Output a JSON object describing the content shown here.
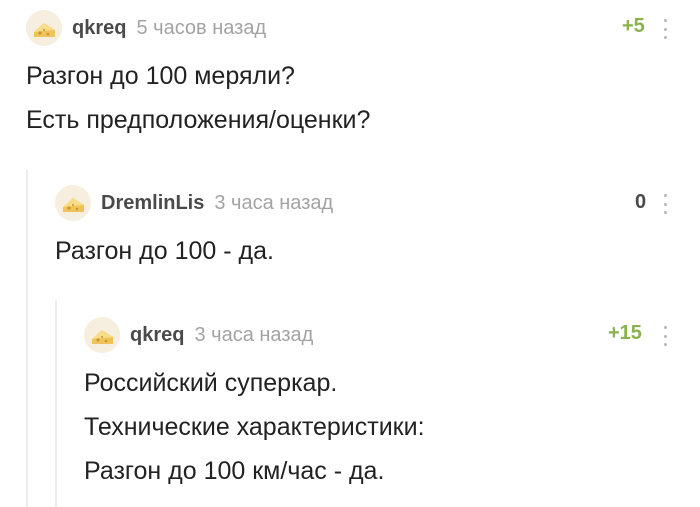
{
  "comments": [
    {
      "author": "qkreq",
      "time": "5 часов назад",
      "rating": "+5",
      "lines": [
        "Разгон до 100 меряли?",
        "Есть предположения/оценки?"
      ]
    },
    {
      "author": "DremlinLis",
      "time": "3 часа назад",
      "rating": "0",
      "lines": [
        "Разгон до 100 - да."
      ]
    },
    {
      "author": "qkreq",
      "time": "3 часа назад",
      "rating": "+15",
      "lines": [
        "Российский суперкар.",
        "Технические характеристики:",
        "Разгон до 100 км/час - да."
      ]
    }
  ],
  "colors": {
    "rating_positive": "#8ab14e",
    "rating_neutral": "#4a4a4a",
    "time": "#a3a3a3",
    "thread_line": "#ececec"
  },
  "icons": {
    "avatar": "cheese-avatar-icon",
    "more": "more-vertical-icon"
  }
}
